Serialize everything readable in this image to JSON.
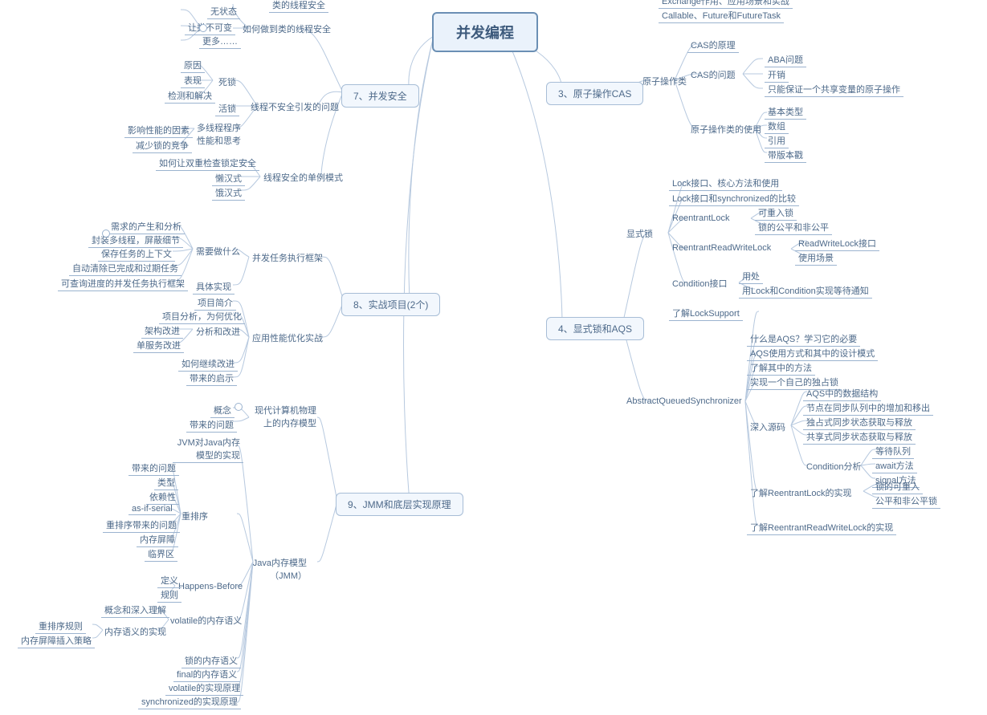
{
  "root": "并发编程",
  "s3": "3、原子操作CAS",
  "s4": "4、显式锁和AQS",
  "s7": "7、并发安全",
  "s8": "8、实战项目(2个)",
  "s9": "9、JMM和底层实现原理",
  "top_cut1": "Exchange作用、应用场景和实战",
  "top_cut2": "Callable、Future和FutureTask",
  "s3_b1": "原子操作类",
  "s3_l1": "CAS的原理",
  "s3_b2": "CAS的问题",
  "s3_l2a": "ABA问题",
  "s3_l2b": "开销",
  "s3_l2c": "只能保证一个共享变量的原子操作",
  "s3_b3": "原子操作类的使用",
  "s3_l3a": "基本类型",
  "s3_l3b": "数组",
  "s3_l3c": "引用",
  "s3_l3d": "带版本戳",
  "s4_b1": "显式锁",
  "s4_l1a": "Lock接口、核心方法和使用",
  "s4_l1b": "Lock接口和synchronized的比较",
  "s4_b1c": "ReentrantLock",
  "s4_l1c1": "可重入锁",
  "s4_l1c2": "锁的公平和非公平",
  "s4_b1d": "ReentrantReadWriteLock",
  "s4_l1d1": "ReadWriteLock接口",
  "s4_l1d2": "使用场景",
  "s4_b1e": "Condition接口",
  "s4_l1e1": "用处",
  "s4_l1e2": "用Lock和Condition实现等待通知",
  "s4_b2": "AbstractQueuedSynchronizer",
  "s4_l2a": "了解LockSupport",
  "s4_l2b": "什么是AQS？学习它的必要",
  "s4_l2c": "AQS使用方式和其中的设计模式",
  "s4_l2d": "了解其中的方法",
  "s4_l2e": "实现一个自己的独占锁",
  "s4_b2f": "深入源码",
  "s4_l2f1": "AQS中的数据结构",
  "s4_l2f2": "节点在同步队列中的增加和移出",
  "s4_l2f3": "独占式同步状态获取与释放",
  "s4_l2f4": "共享式同步状态获取与释放",
  "s4_b2f5": "Condition分析",
  "s4_l2f5a": "等待队列",
  "s4_l2f5b": "await方法",
  "s4_l2f5c": "signal方法",
  "s4_b2g": "了解ReentrantLock的实现",
  "s4_l2g1": "锁的可重入",
  "s4_l2g2": "公平和非公平锁",
  "s4_l2h": "了解ReentrantReadWriteLock的实现",
  "s7_l_top": "类的线程安全",
  "s7_b1": "如何做到类的线程安全",
  "s7_l1a": "无状态",
  "s7_l1b": "让类不可变",
  "s7_l1c": "更多……",
  "s7_b2": "线程不安全引发的问题",
  "s7_b2a": "死锁",
  "s7_l2a1": "原因",
  "s7_l2a2": "表现",
  "s7_l2a3": "检测和解决",
  "s7_l2b": "活锁",
  "s7_b2c": "多线程程序性能和思考",
  "s7_l2c1": "影响性能的因素",
  "s7_l2c2": "减少锁的竞争",
  "s7_b3": "线程安全的单例模式",
  "s7_l3a": "如何让双重检查锁定安全",
  "s7_l3b": "懒汉式",
  "s7_l3c": "饿汉式",
  "s8_b1": "并发任务执行框架",
  "s8_b1a": "需要做什么",
  "s8_l1a1": "需求的产生和分析",
  "s8_l1a2": "封装多线程，屏蔽细节",
  "s8_l1a3": "保存任务的上下文",
  "s8_l1a4": "自动清除已完成和过期任务",
  "s8_l1a5": "可查询进度的并发任务执行框架",
  "s8_l1b": "具体实现",
  "s8_b2": "应用性能优化实战",
  "s8_l2a": "项目简介",
  "s8_l2b": "项目分析，为何优化",
  "s8_b2c": "分析和改进",
  "s8_l2c1": "架构改进",
  "s8_l2c2": "单服务改进",
  "s8_l2d": "如何继续改进",
  "s8_l2e": "带来的启示",
  "s9_b1": "现代计算机物理上的内存模型",
  "s9_l1a": "概念",
  "s9_l1b": "带来的问题",
  "s9_b2": "Java内存模型（JMM）",
  "s9_l2a": "JVM对Java内存模型的实现",
  "s9_b2b": "重排序",
  "s9_l2b1": "带来的问题",
  "s9_l2b2": "类型",
  "s9_l2b3": "依赖性",
  "s9_l2b4": "as-if-serial",
  "s9_l2b5": "重排序带来的问题",
  "s9_l2b6": "内存屏障",
  "s9_l2b7": "临界区",
  "s9_b2c": "Happens-Before",
  "s9_l2c1": "定义",
  "s9_l2c2": "规则",
  "s9_b2d": "volatile的内存语义",
  "s9_l2d1": "概念和深入理解",
  "s9_b2d2": "内存语义的实现",
  "s9_l2d2a": "重排序规则",
  "s9_l2d2b": "内存屏障插入策略",
  "s9_l2e": "锁的内存语义",
  "s9_l2f": "final的内存语义",
  "s9_l2g": "volatile的实现原理",
  "s9_l2h": "synchronized的实现原理"
}
